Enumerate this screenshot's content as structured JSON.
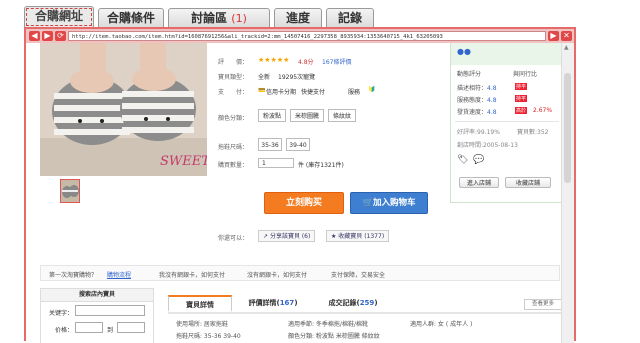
{
  "tabs": [
    {
      "label": "合購網址"
    },
    {
      "label": "合購條件"
    },
    {
      "label": "討論區",
      "badge": "(1)"
    },
    {
      "label": "進度"
    },
    {
      "label": "記錄"
    }
  ],
  "browser": {
    "url": "http://item.taobao.com/item.htm?id=16087691256&ali_trackid=2:mm_14507416_2297358_8935934:1353640715_4k1_63205093"
  },
  "product": {
    "price_label": "評　　價：",
    "rating_text": "4.8分",
    "reviews_text": "167條評價",
    "type_label": "寶貝類型：",
    "type_value": "全新",
    "sold_text": "19295次寵覽",
    "payment_label": "支　　付：",
    "payment_credit": "信用卡分期",
    "payment_fast": "快捷支付",
    "service_label": "服務",
    "color_label": "顏色分類：",
    "colors": [
      "粉波點",
      "米棕圖騰",
      "條紋紋"
    ],
    "size_label": "拖鞋尺碼：",
    "sizes": [
      "35-36",
      "39-40"
    ],
    "qty_label": "購買數量：",
    "qty_value": "1",
    "stock_text": "件 (庫存1321件)",
    "buy_now": "立刻购买",
    "add_cart": "加入购物车",
    "maybe_label": "你還可以：",
    "share_text": "分享該寶貝 (6)",
    "collect_text": "收藏寶貝 (1377)",
    "image_caption": "SWEET"
  },
  "seller": {
    "score_title": "動態評分",
    "compare_title": "與同行比",
    "desc_label": "描述相符：",
    "desc_score": "4.8",
    "desc_tag": "持平",
    "service_label": "服務態度：",
    "service_score": "4.8",
    "service_tag": "持平",
    "ship_label": "發貨速度：",
    "ship_score": "4.8",
    "ship_tag": "高於",
    "ship_compare": "2.67%",
    "good_rate": "好評率:99.19%",
    "items_count": "寶貝數:352",
    "created": "創店時間:2005-08-13",
    "enter_shop": "進入店鋪",
    "collect_shop": "收藏店鋪"
  },
  "notice": {
    "first_time": "第一次淘寶購物？",
    "buy_help": "購物流程",
    "no_card": "我沒有網銀卡，如何支付",
    "no_card2": "沒有網銀卡，如何支付",
    "transaction": "支付保障，交易安全"
  },
  "shop_search": {
    "title": "搜索店內寶貝",
    "keyword_label": "关键字：",
    "price_label": "价格：",
    "to": "到"
  },
  "detail_tabs": [
    {
      "label": "寶貝詳情",
      "count": ""
    },
    {
      "label": "評價詳情",
      "count": "167"
    },
    {
      "label": "成交記錄",
      "count": "259"
    }
  ],
  "detail_link": "查看更多",
  "attributes": {
    "use_place": "使用場所: 居家拖鞋",
    "season": "適用季節: 冬季棉拖/棉鞋/棉靴",
    "people": "適用人群: 女 ( 成年人 )",
    "size": "拖鞋尺碼: 35-36 39-40",
    "colors": "顏色分類: 粉波點 米棕圖騰 條紋紋"
  }
}
